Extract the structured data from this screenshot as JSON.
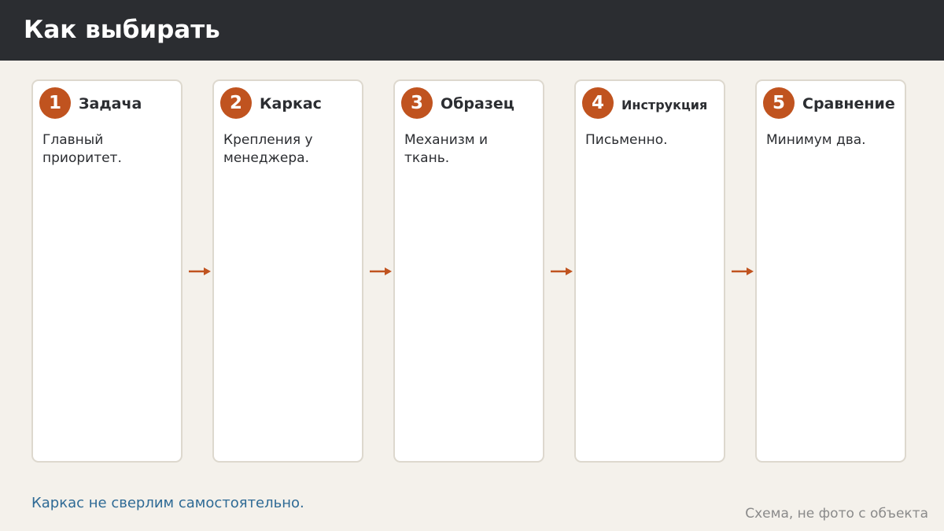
{
  "header": {
    "title": "Как выбирать"
  },
  "steps": [
    {
      "number": "1",
      "title": "Задача",
      "text": "Главный приоритет."
    },
    {
      "number": "2",
      "title": "Каркас",
      "text": "Крепления у менеджера."
    },
    {
      "number": "3",
      "title": "Образец",
      "text": "Механизм и ткань."
    },
    {
      "number": "4",
      "title": "Инструкция",
      "text": "Письменно."
    },
    {
      "number": "5",
      "title": "Сравнение",
      "text": "Минимум два."
    }
  ],
  "footer": {
    "note": "Каркас не сверлим самостоятельно.",
    "caption": "Схема, не фото с объекта"
  },
  "colors": {
    "header_bg": "#2b2d31",
    "accent": "#c0531f",
    "note": "#2e6a95",
    "background": "#f4f1eb"
  }
}
